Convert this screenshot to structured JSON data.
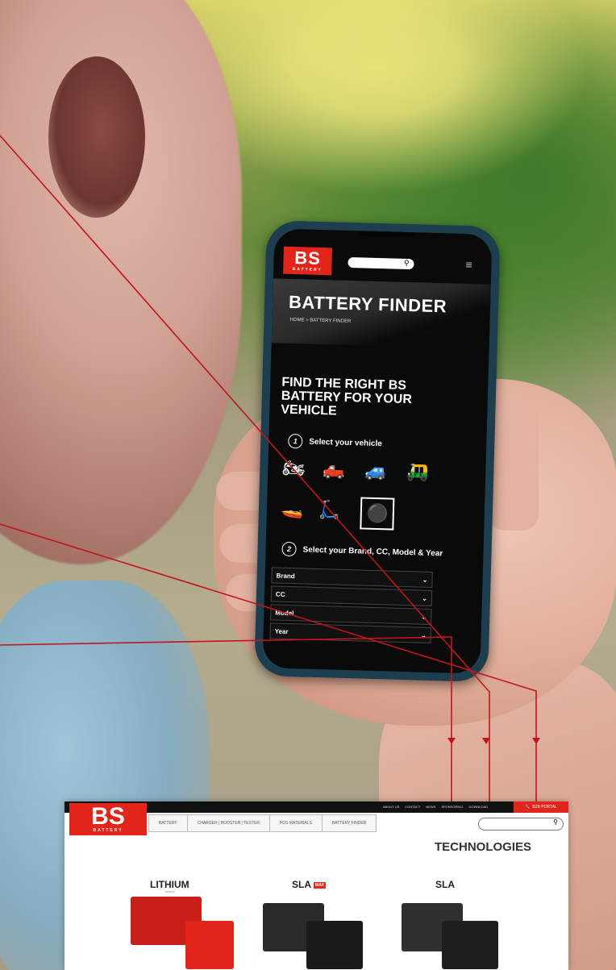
{
  "colors": {
    "brand_red": "#e1251b",
    "callout_red": "#c0161b",
    "phone_screen": "#0a0a0a"
  },
  "phone": {
    "logo": {
      "text": "BS",
      "subtext": "BATTERY"
    },
    "search_icon": "search-icon",
    "menu_icon": "hamburger-icon",
    "page_title": "BATTERY FINDER",
    "breadcrumb": "HOME > BATTERY FINDER",
    "heading_lines": [
      "FIND THE RIGHT BS",
      "BATTERY FOR YOUR",
      "VEHICLE"
    ],
    "step1": {
      "number": "1",
      "label": "Select your vehicle"
    },
    "vehicles": [
      "motorcycle",
      "atv",
      "utv",
      "snowmobile",
      "jet-ski",
      "scooter",
      "lawn-mower"
    ],
    "selected_vehicle": "lawn-mower",
    "step2": {
      "number": "2",
      "label": "Select your Brand, CC, Model & Year"
    },
    "selects": [
      {
        "label": "Brand"
      },
      {
        "label": "CC"
      },
      {
        "label": "Model"
      },
      {
        "label": "Year"
      }
    ]
  },
  "desktop": {
    "logo": {
      "text": "BS",
      "subtext": "BATTERY"
    },
    "top_links": [
      "ABOUT US",
      "CONTACT",
      "NEWS",
      "SPONSORING",
      "DOWNLOAD"
    ],
    "b2b_label": "B2B PORTAL",
    "nav": [
      "BATTERY",
      "CHARGER | BOOSTER | TESTER",
      "POS MATERIALS",
      "BATTERY FINDER"
    ],
    "section_title": "TECHNOLOGIES",
    "products": [
      {
        "label": "LITHIUM",
        "sublabel": "LiFePO4"
      },
      {
        "label": "SLA",
        "badge": "MAX"
      },
      {
        "label": "SLA"
      }
    ]
  }
}
